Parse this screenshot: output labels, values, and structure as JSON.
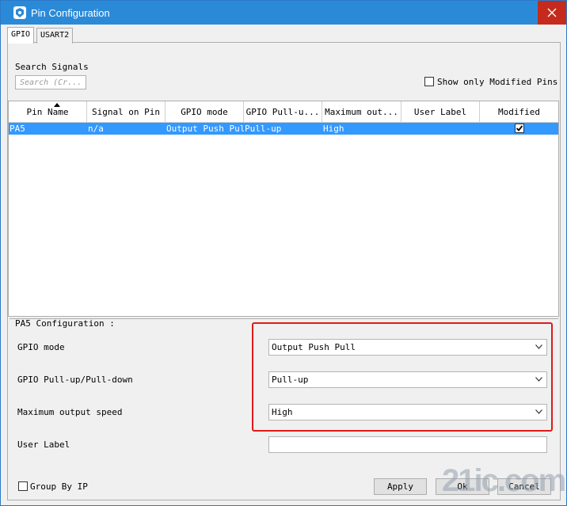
{
  "window": {
    "title": "Pin Configuration"
  },
  "tabs": [
    {
      "label": "GPIO",
      "active": true
    },
    {
      "label": "USART2",
      "active": false
    }
  ],
  "search": {
    "label": "Search Signals",
    "placeholder": "Search (Cr..."
  },
  "filter": {
    "label": "Show only Modified Pins",
    "checked": false
  },
  "table": {
    "columns": [
      "Pin Name",
      "Signal on Pin",
      "GPIO mode",
      "GPIO Pull-u...",
      "Maximum out...",
      "User Label",
      "Modified"
    ],
    "rows": [
      {
        "pin": "PA5",
        "signal": "n/a",
        "mode": "Output Push Pull",
        "pull": "Pull-up",
        "speed": "High",
        "label": "",
        "modified": true
      }
    ]
  },
  "config": {
    "title": "PA5 Configuration :",
    "gpio_mode_label": "GPIO mode",
    "gpio_mode_value": "Output Push Pull",
    "pull_label": "GPIO Pull-up/Pull-down",
    "pull_value": "Pull-up",
    "speed_label": "Maximum output speed",
    "speed_value": "High",
    "user_label_label": "User Label",
    "user_label_value": ""
  },
  "footer": {
    "group_by_ip": "Group By IP",
    "apply": "Apply",
    "ok": "Ok",
    "cancel": "Cancel"
  },
  "watermark": "21ic.com",
  "colors": {
    "title_bar": "#2b8ad8",
    "selection": "#3399ff",
    "highlight_box": "#e01a1a",
    "close_button": "#c42b1c"
  }
}
